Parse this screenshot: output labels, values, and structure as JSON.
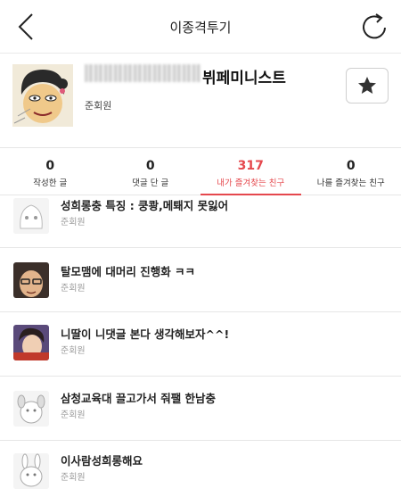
{
  "header": {
    "title": "이종격투기",
    "back_icon": "chevron-left-icon",
    "refresh_icon": "refresh-icon"
  },
  "profile": {
    "nickname_suffix": "뷔페미니스트",
    "grade": "준회원",
    "favorite_icon": "star-icon"
  },
  "tabs": [
    {
      "count": "0",
      "label": "작성한 글"
    },
    {
      "count": "0",
      "label": "댓글 단 글"
    },
    {
      "count": "317",
      "label": "내가 즐겨찾는 친구"
    },
    {
      "count": "0",
      "label": "나를 즐겨찾는 친구"
    }
  ],
  "active_tab": 2,
  "accent_color": "#e5484d",
  "friends": [
    {
      "name": "성희롱충 특징 : 쿵쾅,메퇘지 못잃어",
      "grade": "준회원"
    },
    {
      "name": "탈모맴에 대머리 진행화 ㅋㅋ",
      "grade": "준회원"
    },
    {
      "name": "니딸이 니댓글 본다 생각해보자^^!",
      "grade": "준회원"
    },
    {
      "name": "삼청교육대 끌고가서 줘팰 한남충",
      "grade": "준회원"
    },
    {
      "name": "이사람성희롱해요",
      "grade": "준회원"
    }
  ]
}
